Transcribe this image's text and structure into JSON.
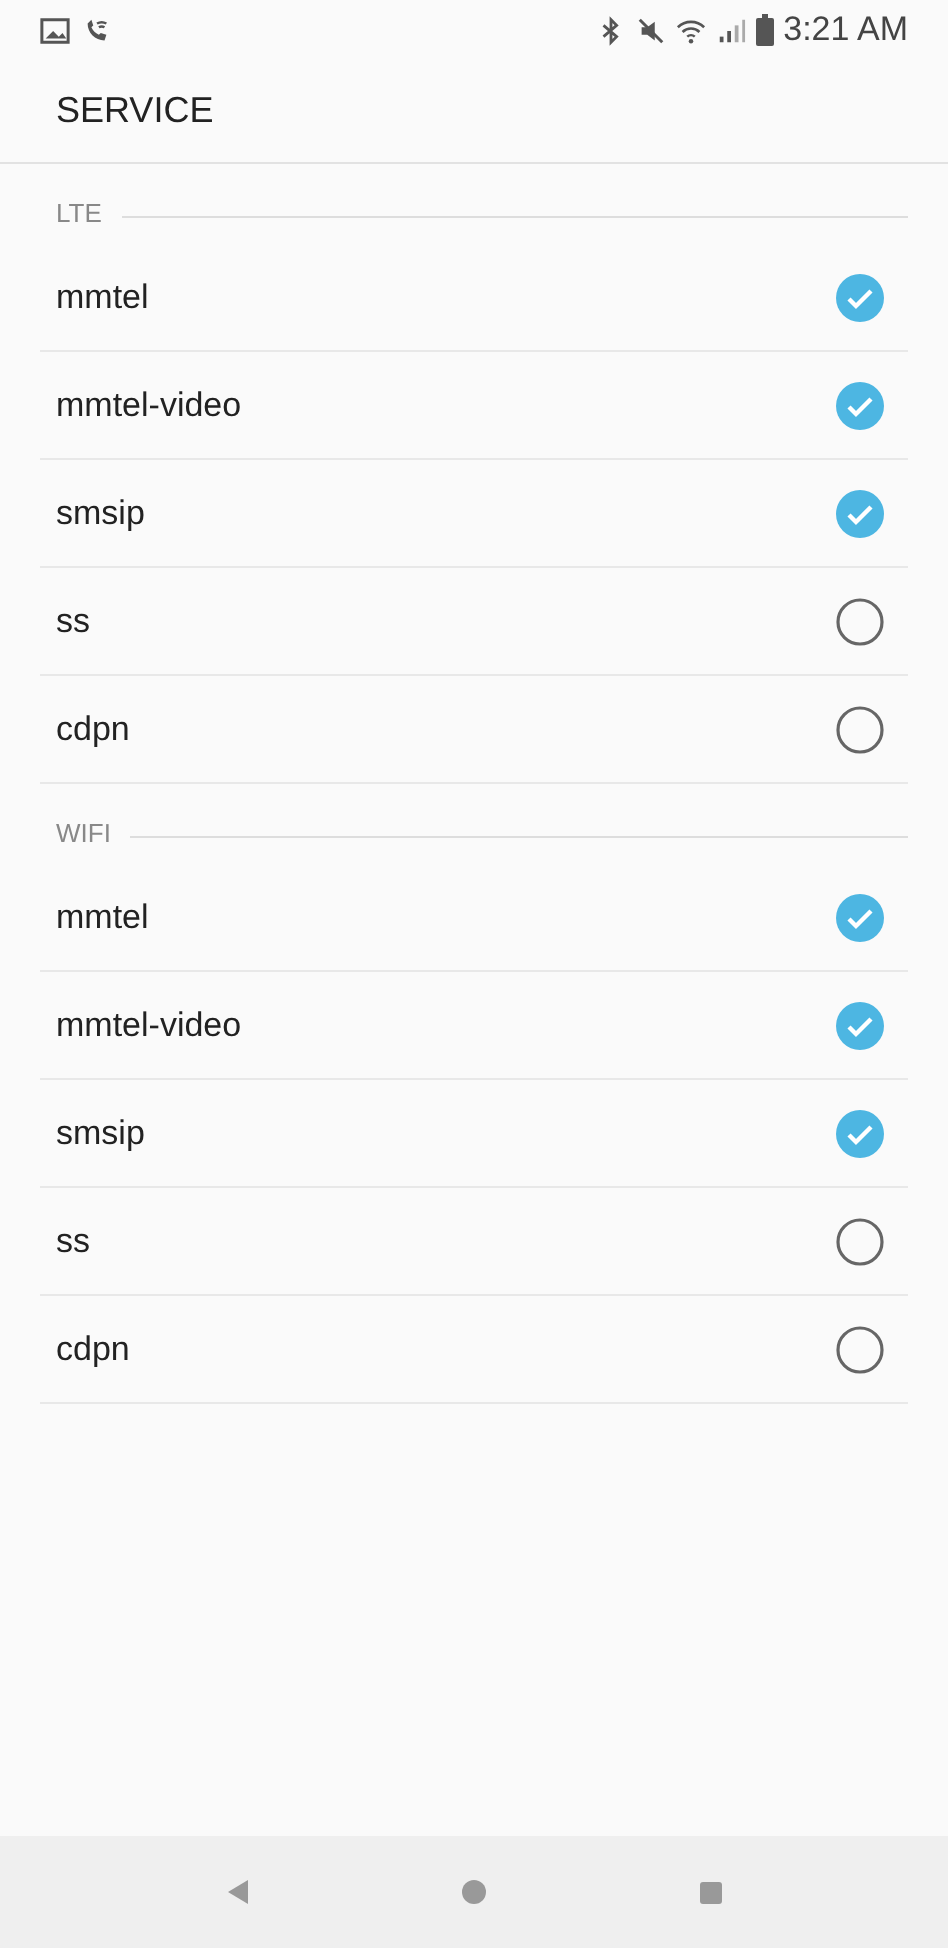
{
  "status_bar": {
    "time": "3:21 AM"
  },
  "header": {
    "title": "SERVICE"
  },
  "sections": [
    {
      "title": "LTE",
      "items": [
        {
          "label": "mmtel",
          "checked": true
        },
        {
          "label": "mmtel-video",
          "checked": true
        },
        {
          "label": "smsip",
          "checked": true
        },
        {
          "label": "ss",
          "checked": false
        },
        {
          "label": "cdpn",
          "checked": false
        }
      ]
    },
    {
      "title": "WIFI",
      "items": [
        {
          "label": "mmtel",
          "checked": true
        },
        {
          "label": "mmtel-video",
          "checked": true
        },
        {
          "label": "smsip",
          "checked": true
        },
        {
          "label": "ss",
          "checked": false
        },
        {
          "label": "cdpn",
          "checked": false
        }
      ]
    }
  ]
}
